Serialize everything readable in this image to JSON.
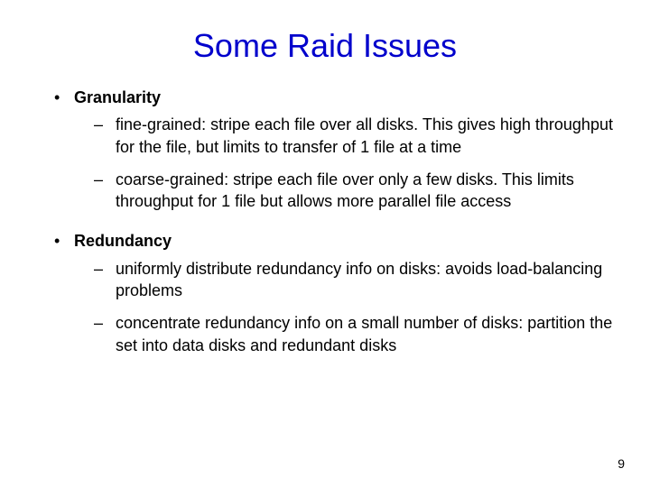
{
  "title": "Some Raid Issues",
  "page_number": "9",
  "bullets": [
    {
      "topic": "Granularity",
      "subs": [
        "fine-grained: stripe each file over all disks.  This gives high throughput for the file, but limits to transfer of 1 file at a time",
        "coarse-grained: stripe each file over only a few disks.  This limits throughput for 1 file but allows more parallel file access"
      ]
    },
    {
      "topic": "Redundancy",
      "subs": [
        "uniformly distribute redundancy info on disks: avoids load-balancing problems",
        "concentrate redundancy info on a small number of disks: partition the set into data disks and redundant disks"
      ]
    }
  ]
}
